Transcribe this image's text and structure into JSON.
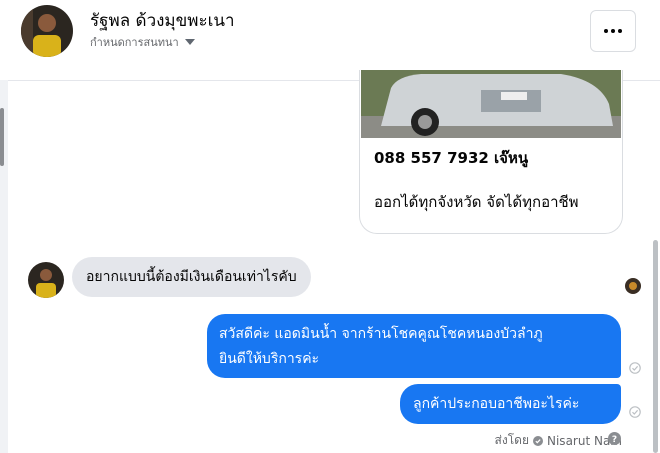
{
  "header": {
    "name": "รัฐพล ด้วงมุขพะเนา",
    "settings_label": "กำหนดการสนทนา"
  },
  "ad": {
    "phone": "088 557 7932 เจ๊หนู",
    "description": "ออกได้ทุกจังหวัด จัดได้ทุกอาชีพ"
  },
  "messages": {
    "incoming": "อยากแบบนี้ต้องมีเงินเดือนเท่าไรคับ",
    "outgoing_1_line1": "สวัสดีค่ะ แอดมินน้ำ จากร้านโชคคูณโชคหนองบัวลำภู",
    "outgoing_1_line2": "ยินดีให้บริการค่ะ",
    "outgoing_2": "ลูกค้าประกอบอาชีพอะไรค่ะ"
  },
  "footer": {
    "sent_by_label": "ส่งโดย",
    "sender_name": "Nisarut Nam"
  },
  "colors": {
    "accent": "#1877f2",
    "incoming_bubble": "#e4e6eb",
    "secondary_text": "#65676b"
  }
}
